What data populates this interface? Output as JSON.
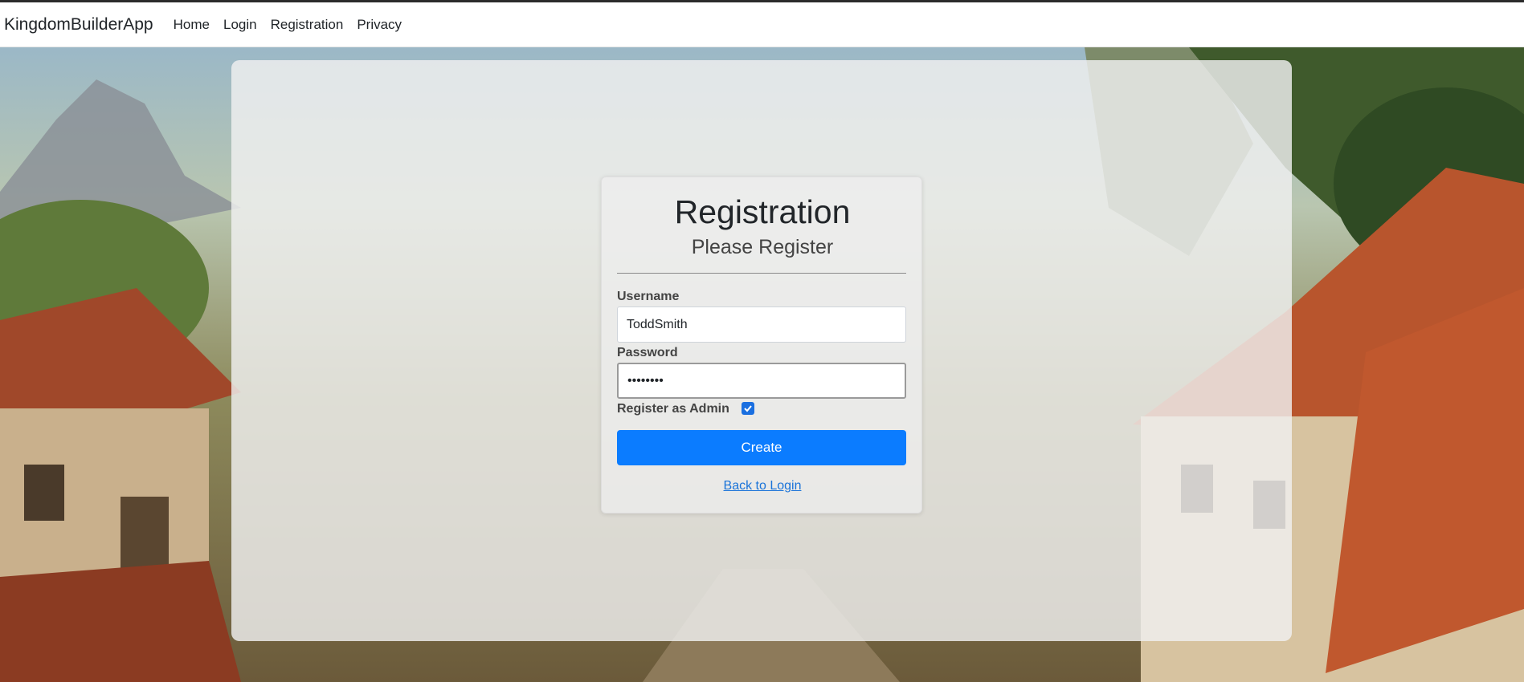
{
  "navbar": {
    "brand": "KingdomBuilderApp",
    "links": [
      "Home",
      "Login",
      "Registration",
      "Privacy"
    ]
  },
  "form": {
    "title": "Registration",
    "subtitle": "Please Register",
    "username_label": "Username",
    "username_value": "ToddSmith",
    "password_label": "Password",
    "password_value": "••••••••",
    "admin_label": "Register as Admin",
    "admin_checked": true,
    "submit_label": "Create",
    "back_link": "Back to Login"
  },
  "colors": {
    "primary": "#0b7cff",
    "link": "#1a73d9",
    "checkbox": "#1a6fe0"
  }
}
